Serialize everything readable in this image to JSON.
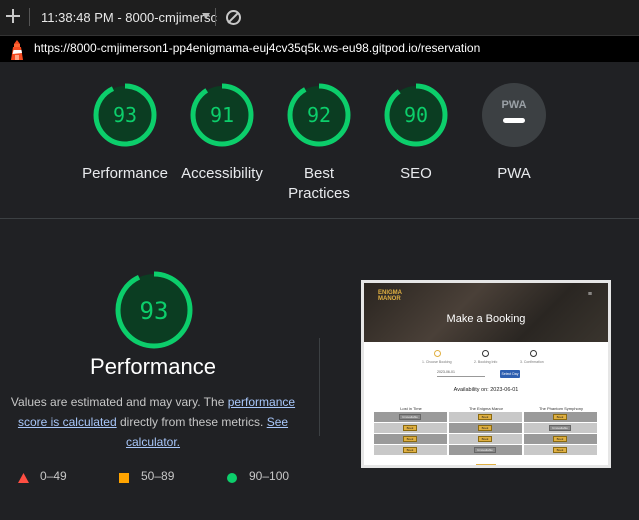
{
  "toolbar": {
    "run_label": "11:38:48 PM - 8000-cmjimersc"
  },
  "url": "https://8000-cmjimerson1-pp4enigmama-euj4cv35q5k.ws-eu98.gitpod.io/reservation",
  "colors": {
    "pass": "#0cce6b",
    "pass_bg": "#0b3d22",
    "average": "#ffa400",
    "fail": "#ff4e42",
    "pwa_bg": "#3c4043"
  },
  "gauges": [
    {
      "score": "93",
      "label": "Performance"
    },
    {
      "score": "91",
      "label": "Accessibility"
    },
    {
      "score": "92",
      "label": "Best\nPractices",
      "label_line1": "Best",
      "label_line2": "Practices"
    },
    {
      "score": "90",
      "label": "SEO"
    },
    {
      "label": "PWA",
      "badge_text": "PWA"
    }
  ],
  "detail": {
    "score": "93",
    "title": "Performance",
    "desc_pre": "Values are estimated and may vary. The ",
    "desc_link1": "performance score is calculated",
    "desc_mid": " directly from these metrics. ",
    "desc_link2": "See calculator.",
    "legend": [
      {
        "icon": "triangle-icon",
        "range": "0–49"
      },
      {
        "icon": "square-icon",
        "range": "50–89"
      },
      {
        "icon": "circle-icon",
        "range": "90–100"
      }
    ]
  },
  "thumbnail": {
    "logo_line1": "ENIGMA",
    "logo_line2": "MANOR",
    "menu": "≡",
    "title": "Make a Booking",
    "steps": [
      "1. Choose Booking",
      "2. Booking Info",
      "3. Confirmation"
    ],
    "date_input": "2023-06-01",
    "button": "Select Day",
    "availability": "Availability on: 2023-06-01",
    "columns": [
      "Lost in Time",
      "The Enigma Manor",
      "The Phantom Symphony"
    ],
    "book": "Book",
    "unavailable": "Unavailable"
  }
}
